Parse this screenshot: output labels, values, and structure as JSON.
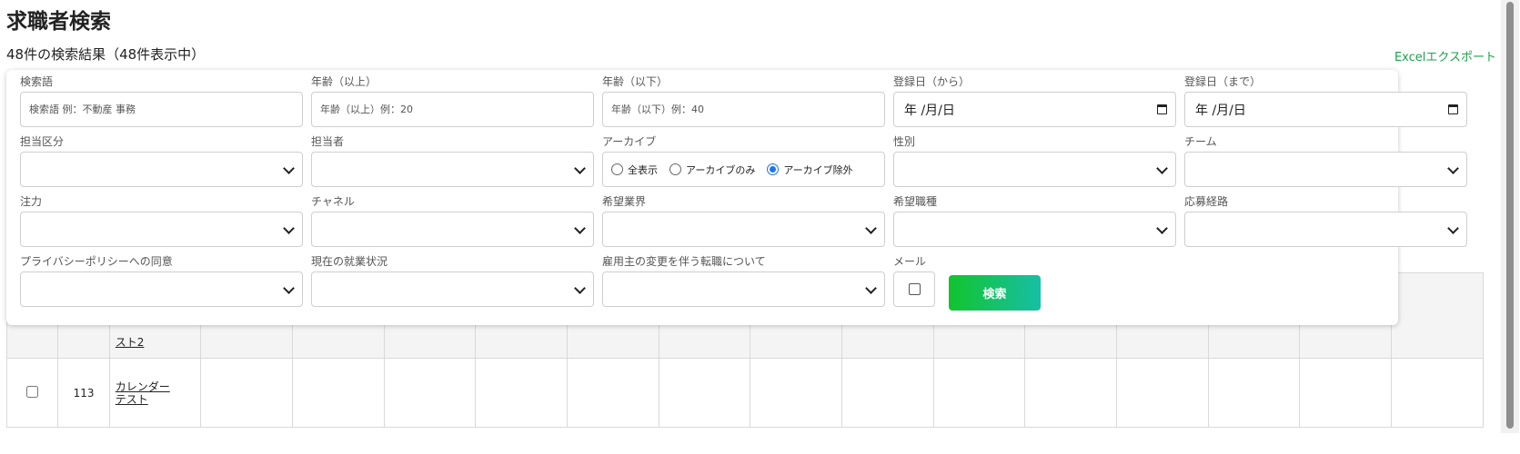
{
  "page": {
    "title": "求職者検索",
    "result_count": "48件の検索結果（48件表示中）",
    "excel_export": "Excelエクスポート"
  },
  "filters": {
    "keyword": {
      "label": "検索語",
      "placeholder": "検索語 例：不動産 事務"
    },
    "age_min": {
      "label": "年齢（以上）",
      "placeholder": "年齢（以上）例：20"
    },
    "age_max": {
      "label": "年齢（以下）",
      "placeholder": "年齢（以下）例：40"
    },
    "reg_from": {
      "label": "登録日（から）",
      "value": "年 /月/日"
    },
    "reg_to": {
      "label": "登録日（まで）",
      "value": "年 /月/日"
    },
    "owner_type": {
      "label": "担当区分",
      "value": ""
    },
    "owner": {
      "label": "担当者",
      "value": ""
    },
    "archive": {
      "label": "アーカイブ",
      "options": [
        "全表示",
        "アーカイブのみ",
        "アーカイブ除外"
      ],
      "selected": "アーカイブ除外"
    },
    "gender": {
      "label": "性別",
      "value": ""
    },
    "team": {
      "label": "チーム",
      "value": ""
    },
    "focus": {
      "label": "注力",
      "value": ""
    },
    "channel": {
      "label": "チャネル",
      "value": ""
    },
    "industry": {
      "label": "希望業界",
      "value": ""
    },
    "job_type": {
      "label": "希望職種",
      "value": ""
    },
    "route": {
      "label": "応募経路",
      "value": ""
    },
    "privacy": {
      "label": "プライバシーポリシーへの同意",
      "value": ""
    },
    "employment": {
      "label": "現在の就業状況",
      "value": ""
    },
    "employer_change": {
      "label": "雇用主の変更を伴う転職について",
      "value": ""
    },
    "mail": {
      "label": "メール",
      "checked": false
    },
    "search_button": "検索"
  },
  "table": {
    "rows": [
      {
        "id": "",
        "name": "スト2"
      },
      {
        "id": "113",
        "name_line1": "カレンダー",
        "name_line2": "テスト"
      }
    ]
  }
}
